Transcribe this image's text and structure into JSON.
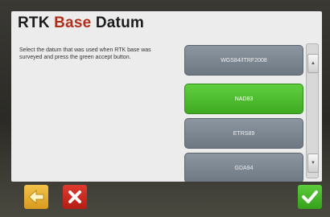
{
  "header": {
    "title_word1": "RTK",
    "title_word2": "Base",
    "title_word3": "Datum"
  },
  "instructions": "Select the datum that was used when RTK base was surveyed and press the green accept button.",
  "datum_options": [
    {
      "label": "WGS84/ITRF2008",
      "selected": false
    },
    {
      "label": "NAD83",
      "selected": true
    },
    {
      "label": "ETRS89",
      "selected": false
    },
    {
      "label": "GDA94",
      "selected": false
    }
  ],
  "colors": {
    "selected": "#4cbf2c",
    "unselected": "#7d8791",
    "title_accent": "#b0301c",
    "back": "#e6ae30",
    "cancel": "#cc2a20",
    "accept": "#48b82a"
  },
  "icons": {
    "back": "arrow-left-icon",
    "cancel": "x-icon",
    "accept": "checkmark-icon",
    "scroll_up": "scroll-up-arrow-icon",
    "scroll_down": "scroll-down-arrow-icon"
  }
}
